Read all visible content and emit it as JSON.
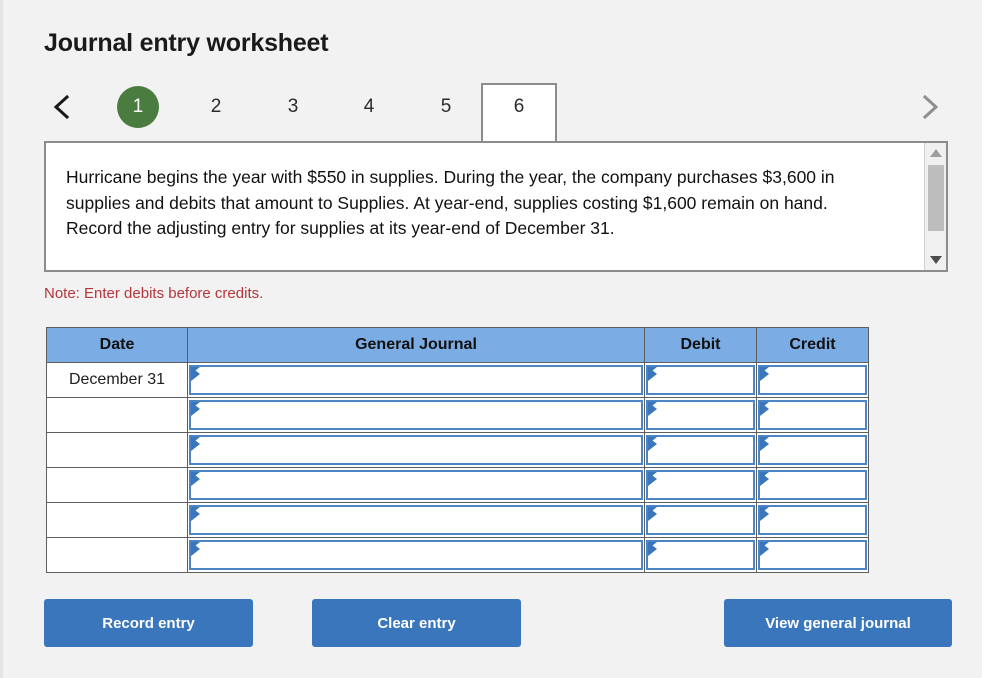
{
  "page": {
    "title": "Journal entry worksheet"
  },
  "tabs": {
    "prev_icon": "chevron-left-icon",
    "next_icon": "chevron-right-icon",
    "items": [
      {
        "label": "1",
        "state": "done"
      },
      {
        "label": "2",
        "state": "normal"
      },
      {
        "label": "3",
        "state": "normal"
      },
      {
        "label": "4",
        "state": "normal"
      },
      {
        "label": "5",
        "state": "normal"
      },
      {
        "label": "6",
        "state": "active"
      }
    ],
    "done_color": "#4a7c3f",
    "active_bg": "#ffffff"
  },
  "problem": {
    "text": "Hurricane begins the year with $550 in supplies. During the year, the company purchases $3,600 in supplies and debits that amount to Supplies. At year-end, supplies costing $1,600 remain on hand. Record the adjusting entry for supplies at its year-end of December 31.",
    "scroll_up_icon": "scroll-up-arrow-icon",
    "scroll_down_icon": "scroll-down-arrow-icon"
  },
  "note": {
    "text": "Note: Enter debits before credits.",
    "color": "#b4353a"
  },
  "journal": {
    "header_color": "#7cace4",
    "columns": [
      "Date",
      "General Journal",
      "Debit",
      "Credit"
    ],
    "rows": [
      {
        "date": "December 31",
        "account": "",
        "debit": "",
        "credit": ""
      },
      {
        "date": "",
        "account": "",
        "debit": "",
        "credit": ""
      },
      {
        "date": "",
        "account": "",
        "debit": "",
        "credit": ""
      },
      {
        "date": "",
        "account": "",
        "debit": "",
        "credit": ""
      },
      {
        "date": "",
        "account": "",
        "debit": "",
        "credit": ""
      },
      {
        "date": "",
        "account": "",
        "debit": "",
        "credit": ""
      }
    ]
  },
  "buttons": {
    "color": "#3a76bb",
    "record_entry": "Record entry",
    "clear_entry": "Clear entry",
    "view_general_journal": "View general journal"
  }
}
